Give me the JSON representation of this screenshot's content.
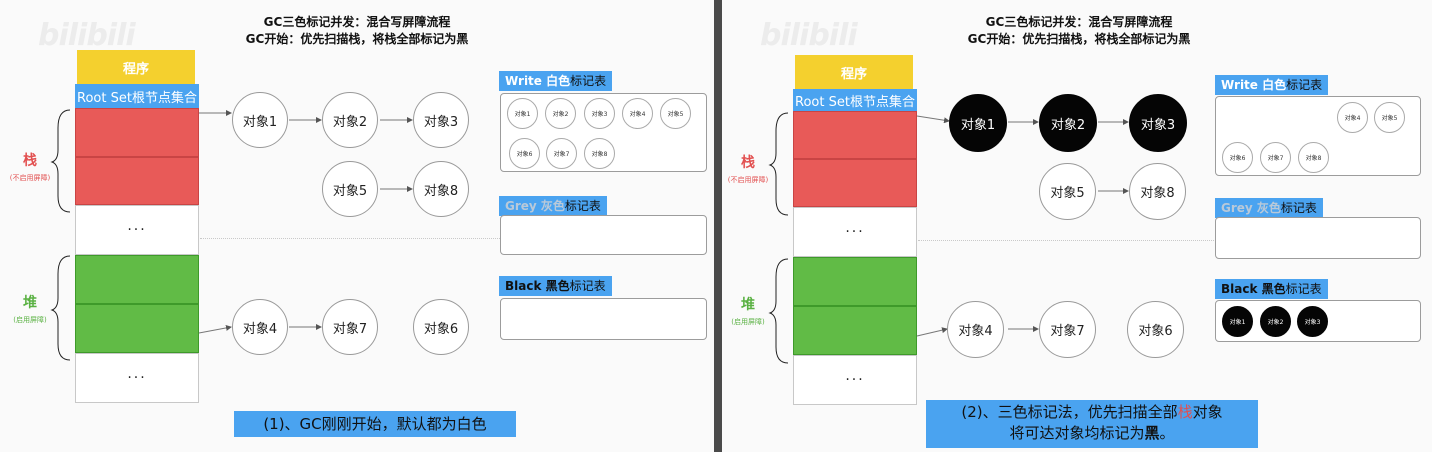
{
  "titles": {
    "line1": "GC三色标记并发：混合写屏障流程",
    "line2": "GC开始：优先扫描栈，将栈全部标记为黑"
  },
  "watermark": "bilibili",
  "program_label": "程序",
  "rootset_label": "Root Set根节点集合",
  "stack_label": "栈",
  "stack_sub": "(不启用屏障)",
  "heap_label": "堆",
  "heap_sub": "(启用屏障)",
  "ellipsis": "···",
  "tables": {
    "white": {
      "prefix": "Write 白色",
      "suffix": "标记表"
    },
    "grey": {
      "prefix": "Grey 灰色",
      "suffix": "标记表"
    },
    "black": {
      "prefix": "Black 黑色",
      "suffix": "标记表"
    }
  },
  "nodes": {
    "n1": "对象1",
    "n2": "对象2",
    "n3": "对象3",
    "n4": "对象4",
    "n5": "对象5",
    "n6": "对象6",
    "n7": "对象7",
    "n8": "对象8"
  },
  "slide1": {
    "white_table": [
      "对象1",
      "对象2",
      "对象3",
      "对象4",
      "对象5",
      "对象6",
      "对象7",
      "对象8"
    ],
    "caption": "(1)、GC刚刚开始，默认都为白色"
  },
  "slide2": {
    "white_table": [
      "对象4",
      "对象5",
      "对象6",
      "对象7",
      "对象8"
    ],
    "black_table": [
      "对象1",
      "对象2",
      "对象3"
    ],
    "caption_line1_a": "(2)、三色标记法，优先扫描全部",
    "caption_line1_b": "栈",
    "caption_line1_c": "对象",
    "caption_line2_a": "将可达对象均标记为",
    "caption_line2_b": "黑",
    "caption_line2_c": "。"
  },
  "colors": {
    "program": "#f4d02e",
    "rootset": "#4aa3f0",
    "stack": "#e85a58",
    "heap": "#61bb46",
    "black_node": "#050505",
    "caption_bg": "#4aa3f0"
  }
}
